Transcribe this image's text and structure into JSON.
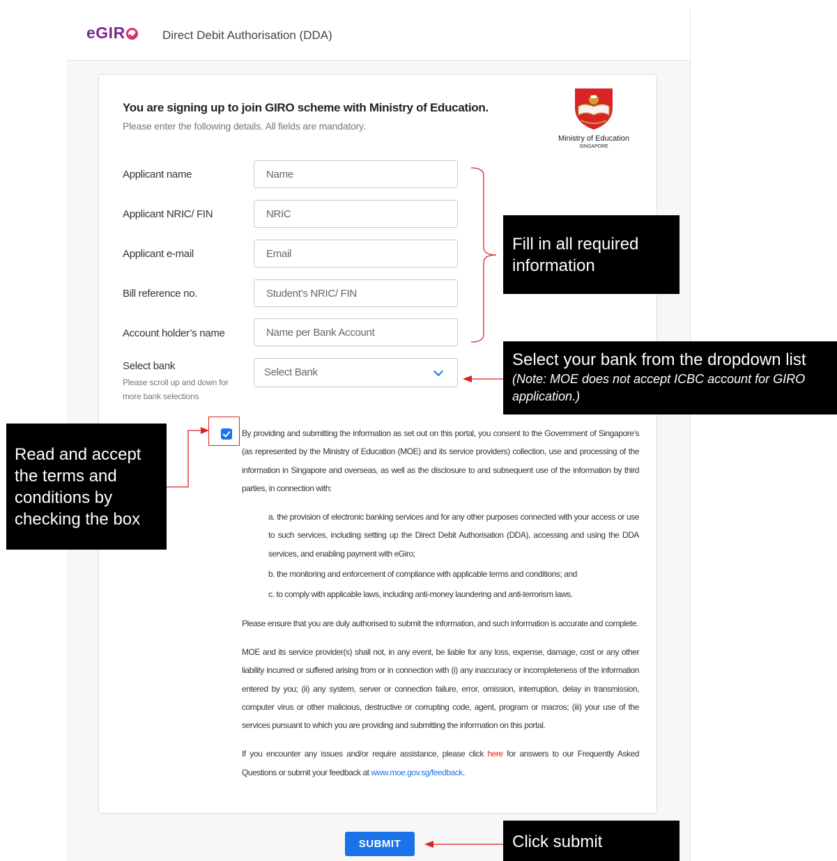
{
  "header": {
    "logo": "eGIR",
    "title": "Direct Debit Authorisation (DDA)"
  },
  "card": {
    "heading": "You are signing up to join GIRO scheme with Ministry of Education.",
    "subheading": "Please enter the following details. All fields are mandatory.",
    "org": {
      "name": "Ministry of Education",
      "country": "SINGAPORE"
    }
  },
  "form": {
    "applicant_name": {
      "label": "Applicant name",
      "placeholder": "Name"
    },
    "nric": {
      "label": "Applicant NRIC/ FIN",
      "placeholder": "NRIC"
    },
    "email": {
      "label": "Applicant e-mail",
      "placeholder": "Email"
    },
    "bill_ref": {
      "label": "Bill reference no.",
      "placeholder": "Student’s NRIC/ FIN"
    },
    "holder": {
      "label": "Account holder’s name",
      "placeholder": "Name per Bank Account"
    },
    "bank": {
      "label": "Select bank",
      "hint": "Please scroll up and down for more bank selections",
      "value": "Select Bank"
    },
    "consent_checked": true
  },
  "terms": {
    "intro": "By providing and submitting the information as set out on this portal, you consent to the Government of Singapore’s (as represented by the Ministry of Education (MOE) and its service providers) collection, use and processing of the information in Singapore and overseas, as well as the disclosure to and subsequent use of the information by third parties, in connection with:",
    "item_a": "a. the provision of electronic banking services and for any other purposes connected with your access or use to such services, including setting up the Direct Debit Authorisation (DDA), accessing and using the DDA services, and enabling payment with eGiro;",
    "item_b": "b. the monitoring and enforcement of compliance with applicable terms and conditions; and",
    "item_c": "c. to comply with applicable laws, including anti-money laundering and anti-terrorism laws.",
    "ensure": "Please ensure that you are duly authorised to submit the information, and such information is accurate and complete.",
    "liability": "MOE and its service provider(s) shall not, in any event, be liable for any loss, expense, damage, cost or any other liability incurred or suffered arising from or in connection with (i) any inaccuracy or incompleteness of the information entered by you; (ii) any system, server or connection failure, error, omission, interruption, delay in transmission, computer virus or other malicious, destructive or corrupting code, agent, program or macros; (iii) your use of the services pursuant to which you are providing and submitting the information on this portal.",
    "help_pre": "If you encounter any issues and/or require assistance, please click ",
    "help_link": "here",
    "help_mid": " for answers to our Frequently Asked Questions or submit your feedback at ",
    "feedback_link": "www.moe.gov.sg/feedback",
    "help_end": "."
  },
  "submit_label": "SUBMIT",
  "callouts": {
    "fill": "Fill in all required information",
    "bank_main": "Select your bank from the dropdown list",
    "bank_note": "(Note: MOE does not accept ICBC account for GIRO application.)",
    "terms": "Read and accept the terms and conditions by checking the box",
    "submit": "Click submit"
  },
  "colors": {
    "primary": "#1a73e8",
    "brand": "#7a2a8c",
    "annotation_red": "#e02020"
  }
}
